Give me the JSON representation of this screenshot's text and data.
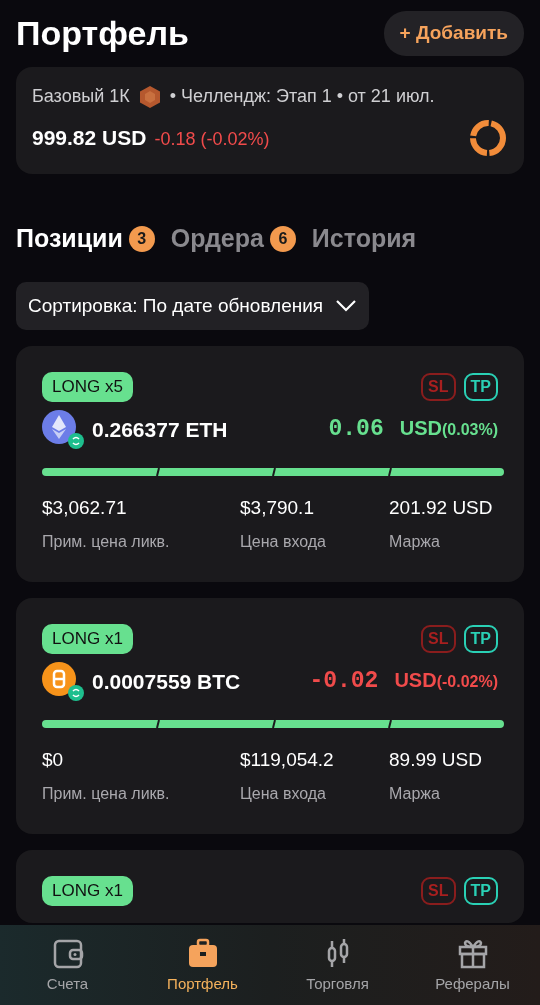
{
  "header": {
    "title": "Портфель",
    "add_button": "+ Добавить"
  },
  "account": {
    "plan": "Базовый 1К",
    "challenge": "• Челлендж: Этап 1 • от 21 июл.",
    "balance": "999.82 USD",
    "change": {
      "text": "-0.18 (-0.02%)",
      "color": "#f14b4b"
    }
  },
  "tabs": [
    {
      "label": "Позиции",
      "count": "3",
      "selected": true
    },
    {
      "label": "Ордера",
      "count": "6",
      "selected": false
    },
    {
      "label": "История",
      "selected": false
    }
  ],
  "sort": {
    "label": "Сортировка: По дате обновления"
  },
  "positions": [
    {
      "side": "LONG x5",
      "kind": "eth",
      "amount": "0.266377 ETH",
      "pnl": {
        "value": "0.06",
        "currency": "USD",
        "percent": "(0.03%)",
        "color": "#67e08f"
      },
      "liq_price": "$3,062.71",
      "liq_label": "Прим. цена ликв.",
      "entry_price": "$3,790.1",
      "entry_label": "Цена входа",
      "margin": "201.92 USD",
      "margin_label": "Маржа",
      "sl": "SL",
      "tp": "TP"
    },
    {
      "side": "LONG x1",
      "kind": "btc",
      "amount": "0.0007559 BTC",
      "pnl": {
        "value": "-0.02",
        "currency": "USD",
        "percent": "(-0.02%)",
        "color": "#f14b4b"
      },
      "liq_price": "$0",
      "liq_label": "Прим. цена ликв.",
      "entry_price": "$119,054.2",
      "entry_label": "Цена входа",
      "margin": "89.99 USD",
      "margin_label": "Маржа",
      "sl": "SL",
      "tp": "TP"
    },
    {
      "side": "LONG x1",
      "sl": "SL",
      "tp": "TP"
    }
  ],
  "bottom_nav": [
    {
      "label": "Счета",
      "kind": "wallet",
      "selected": false
    },
    {
      "label": "Портфель",
      "kind": "briefcase",
      "selected": true
    },
    {
      "label": "Торговля",
      "kind": "candles",
      "selected": false
    },
    {
      "label": "Рефералы",
      "kind": "gift",
      "selected": false
    }
  ]
}
